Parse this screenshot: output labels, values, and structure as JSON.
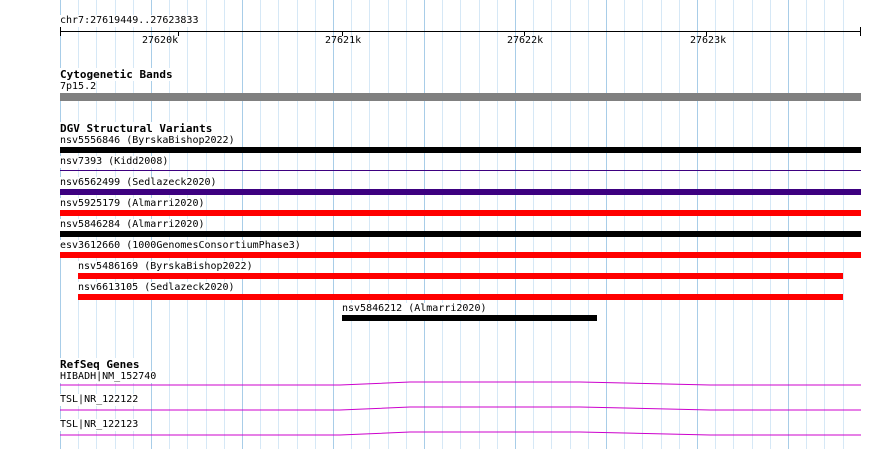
{
  "location": "chr7:27619449..27623833",
  "ruler": {
    "ticks": [
      "27620k",
      "27621k",
      "27622k",
      "27623k"
    ]
  },
  "tracks": {
    "cytoband": {
      "title": "Cytogenetic Bands",
      "band_label": "7p15.2",
      "band_color": "#808080"
    },
    "dgv": {
      "title": "DGV Structural Variants",
      "features": [
        {
          "label": "nsv5556846 (ByrskaBishop2022)",
          "color": "#000000"
        },
        {
          "label": "nsv7393 (Kidd2008)",
          "color": "#3d0080"
        },
        {
          "label": "nsv6562499 (Sedlazeck2020)",
          "color": "#3d0080"
        },
        {
          "label": "nsv5925179 (Almarri2020)",
          "color": "#ff0000"
        },
        {
          "label": "nsv5846284 (Almarri2020)",
          "color": "#000000"
        },
        {
          "label": "esv3612660 (1000GenomesConsortiumPhase3)",
          "color": "#ff0000"
        },
        {
          "label": "nsv5486169 (ByrskaBishop2022)",
          "color": "#ff0000"
        },
        {
          "label": "nsv6613105 (Sedlazeck2020)",
          "color": "#ff0000"
        },
        {
          "label": "nsv5846212 (Almarri2020)",
          "color": "#000000"
        }
      ]
    },
    "refseq": {
      "title": "RefSeq Genes",
      "genes": [
        {
          "label": "HIBADH|NM_152740",
          "color": "#cc00cc"
        },
        {
          "label": "TSL|NR_122122",
          "color": "#cc00cc"
        },
        {
          "label": "TSL|NR_122123",
          "color": "#cc00cc"
        }
      ]
    }
  },
  "colors": {
    "grid_major": "#a8cde8",
    "grid_minor": "#d6e8f6"
  }
}
